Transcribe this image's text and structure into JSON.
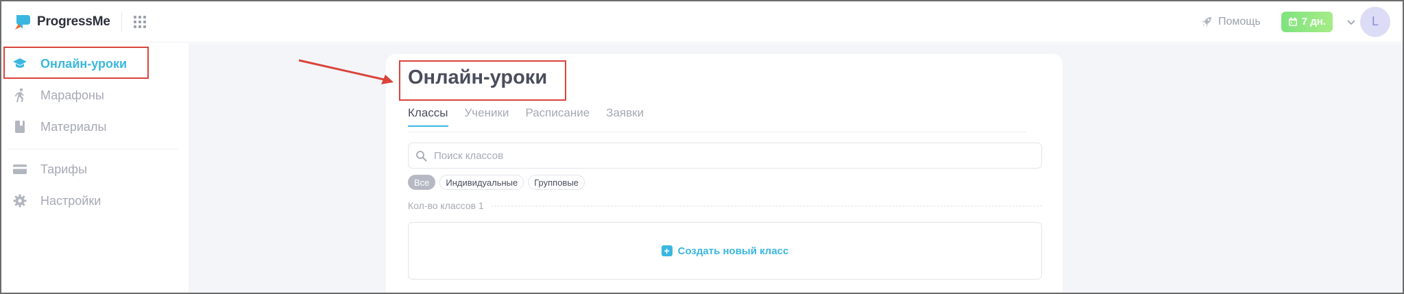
{
  "header": {
    "logo_text": "ProgressMe",
    "help_label": "Помощь",
    "trial_label": "7 дн.",
    "avatar_initial": "L"
  },
  "sidebar": {
    "items": [
      {
        "label": "Онлайн-уроки",
        "icon": "graduation-cap-icon",
        "active": true
      },
      {
        "label": "Марафоны",
        "icon": "running-person-icon"
      },
      {
        "label": "Материалы",
        "icon": "book-icon"
      },
      {
        "label": "Тарифы",
        "icon": "credit-card-icon"
      },
      {
        "label": "Настройки",
        "icon": "gear-icon"
      }
    ]
  },
  "main": {
    "title": "Онлайн-уроки",
    "tabs": [
      {
        "label": "Классы",
        "active": true
      },
      {
        "label": "Ученики"
      },
      {
        "label": "Расписание"
      },
      {
        "label": "Заявки"
      }
    ],
    "search_placeholder": "Поиск классов",
    "filters": [
      {
        "label": "Все",
        "active": true
      },
      {
        "label": "Индивидуальные"
      },
      {
        "label": "Групповые"
      }
    ],
    "count_label": "Кол-во классов 1",
    "create_label": "Создать новый класс"
  },
  "colors": {
    "accent": "#3ab7e0",
    "annotation": "#d9433a",
    "trial_badge": "#8fe884",
    "background": "#f4f5f9"
  }
}
